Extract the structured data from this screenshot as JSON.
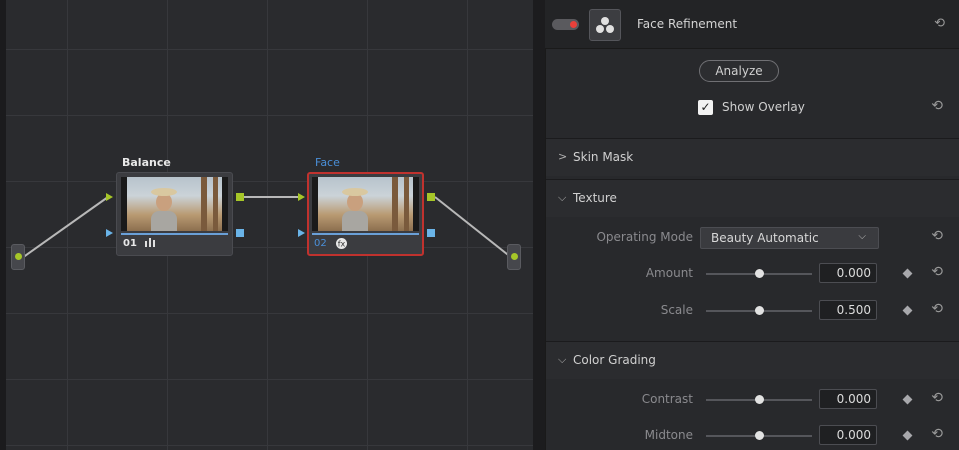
{
  "graph": {
    "nodes": [
      {
        "title": "Balance",
        "number": "01",
        "icon": "histogram-icon",
        "selected": false
      },
      {
        "title": "Face",
        "number": "02",
        "icon": "fx-icon",
        "selected": true
      }
    ]
  },
  "inspector": {
    "enabled": true,
    "title": "Face Refinement",
    "analyze_label": "Analyze",
    "show_overlay": {
      "label": "Show Overlay",
      "checked": true
    },
    "sections": {
      "skin_mask": {
        "label": "Skin Mask",
        "expanded": false
      },
      "texture": {
        "label": "Texture",
        "expanded": true,
        "operating_mode": {
          "label": "Operating Mode",
          "value": "Beauty Automatic"
        },
        "amount": {
          "label": "Amount",
          "value": "0.000",
          "level": 0.5
        },
        "scale": {
          "label": "Scale",
          "value": "0.500",
          "level": 0.5
        }
      },
      "color_grading": {
        "label": "Color Grading",
        "expanded": true,
        "contrast": {
          "label": "Contrast",
          "value": "0.000",
          "level": 0.5
        },
        "midtone": {
          "label": "Midtone",
          "value": "0.000",
          "level": 0.5
        }
      }
    }
  },
  "colors": {
    "accent_green": "#a6c628",
    "accent_blue": "#6ab4e8",
    "selected_node": "#c0322e",
    "toggle_on": "#e8403a"
  }
}
